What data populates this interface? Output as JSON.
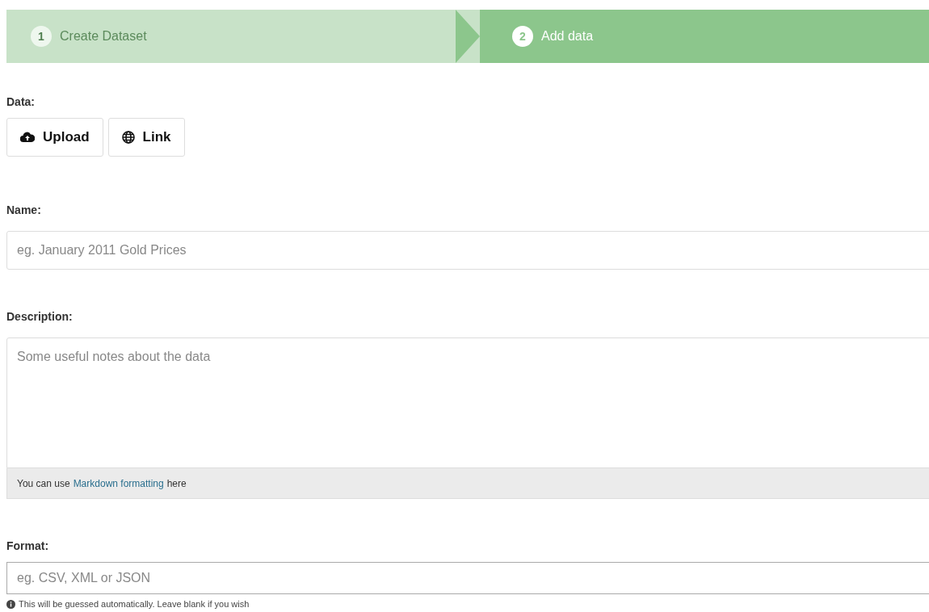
{
  "stages": [
    {
      "number": "1",
      "label": "Create Dataset",
      "selected": false
    },
    {
      "number": "2",
      "label": "Add data",
      "selected": true
    }
  ],
  "data": {
    "label": "Data:",
    "buttons": [
      {
        "kind": "upload",
        "label": "Upload"
      },
      {
        "kind": "link",
        "label": "Link"
      }
    ]
  },
  "name": {
    "label": "Name:",
    "placeholder": "eg. January 2011 Gold Prices"
  },
  "description": {
    "label": "Description:",
    "placeholder": "Some useful notes about the data",
    "hint_before": "You can use",
    "hint_link": "Markdown formatting",
    "hint_after": "here"
  },
  "format": {
    "label": "Format:",
    "placeholder": "eg. CSV, XML or JSON",
    "help": "This will be guessed automatically. Leave blank if you wish"
  }
}
